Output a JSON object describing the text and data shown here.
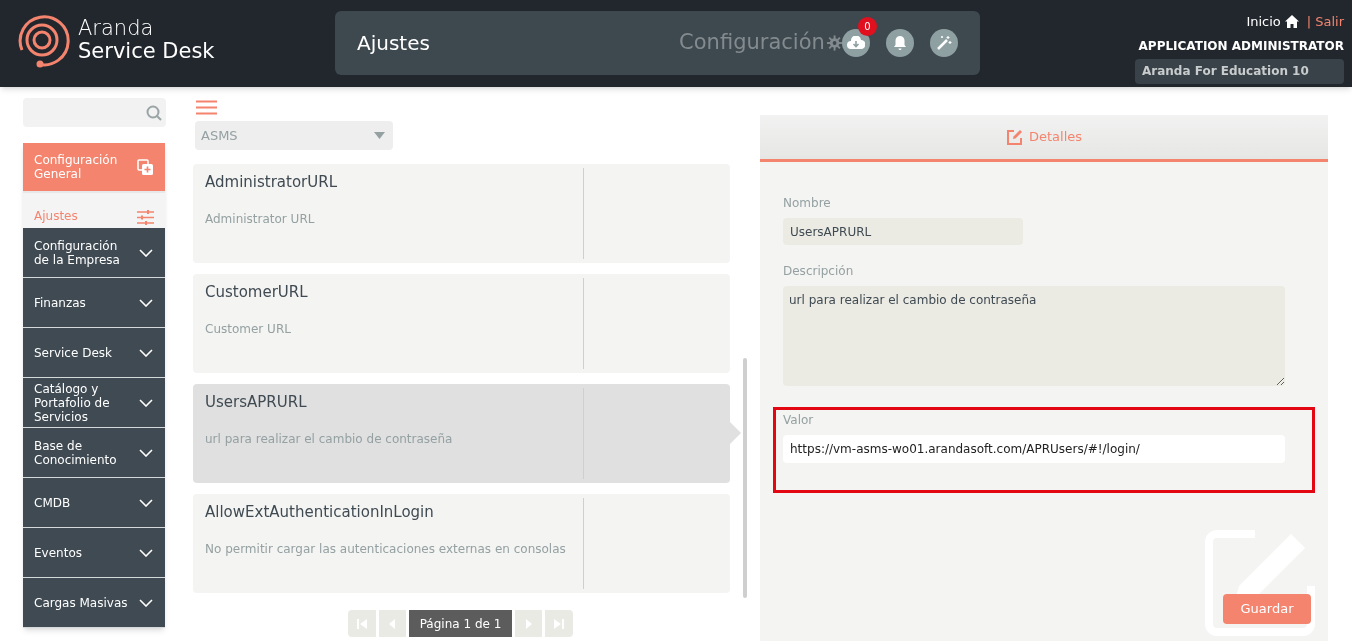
{
  "header": {
    "logo_line1": "Aranda",
    "logo_line2": "Service Desk",
    "page_title": "Ajustes",
    "breadcrumb": "Configuración",
    "download_badge": "0",
    "home_link": "Inicio",
    "separator": "|",
    "logout_link": "Salir",
    "user_role": "APPLICATION ADMINISTRATOR",
    "company": "Aranda For Education 10"
  },
  "sidebar": {
    "items": [
      {
        "label": "Configuración General",
        "kind": "section",
        "selected": true
      },
      {
        "label": "Ajustes",
        "kind": "subheading"
      },
      {
        "label": "Configuración de la Empresa",
        "kind": "group",
        "expanded": false
      },
      {
        "label": "Finanzas",
        "kind": "group",
        "expanded": false
      },
      {
        "label": "Service Desk",
        "kind": "group",
        "expanded": false
      },
      {
        "label": "Catálogo y Portafolio de Servicios",
        "kind": "group",
        "expanded": false
      },
      {
        "label": "Base de Conocimiento",
        "kind": "group",
        "expanded": false
      },
      {
        "label": "CMDB",
        "kind": "group",
        "expanded": false
      },
      {
        "label": "Eventos",
        "kind": "group",
        "expanded": false
      },
      {
        "label": "Cargas Masivas",
        "kind": "group",
        "expanded": false
      }
    ]
  },
  "list": {
    "filter": "ASMS",
    "items": [
      {
        "name": "AdministratorURL",
        "description": "Administrator URL",
        "selected": false
      },
      {
        "name": "CustomerURL",
        "description": "Customer URL",
        "selected": false
      },
      {
        "name": "UsersAPRURL",
        "description": "url para realizar el cambio de contraseña",
        "selected": true
      },
      {
        "name": "AllowExtAuthenticationInLogin",
        "description": "No permitir cargar las autenticaciones externas en consolas",
        "selected": false
      }
    ],
    "pagination": {
      "label": "Página 1 de 1",
      "first_disabled": true,
      "prev_disabled": true,
      "next_disabled": true,
      "last_disabled": true
    }
  },
  "details": {
    "tab": "Detalles",
    "fields": [
      {
        "label": "Nombre",
        "kind": "input",
        "value": "UsersAPRURL",
        "highlighted": false
      },
      {
        "label": "Descripción",
        "kind": "textarea",
        "value": "url para realizar el cambio de contraseña",
        "highlighted": false
      },
      {
        "label": "Valor",
        "kind": "input",
        "value": "https://vm-asms-wo01.arandasoft.com/APRUsers/#!/login/",
        "highlighted": true
      }
    ],
    "save_button": "Guardar"
  }
}
